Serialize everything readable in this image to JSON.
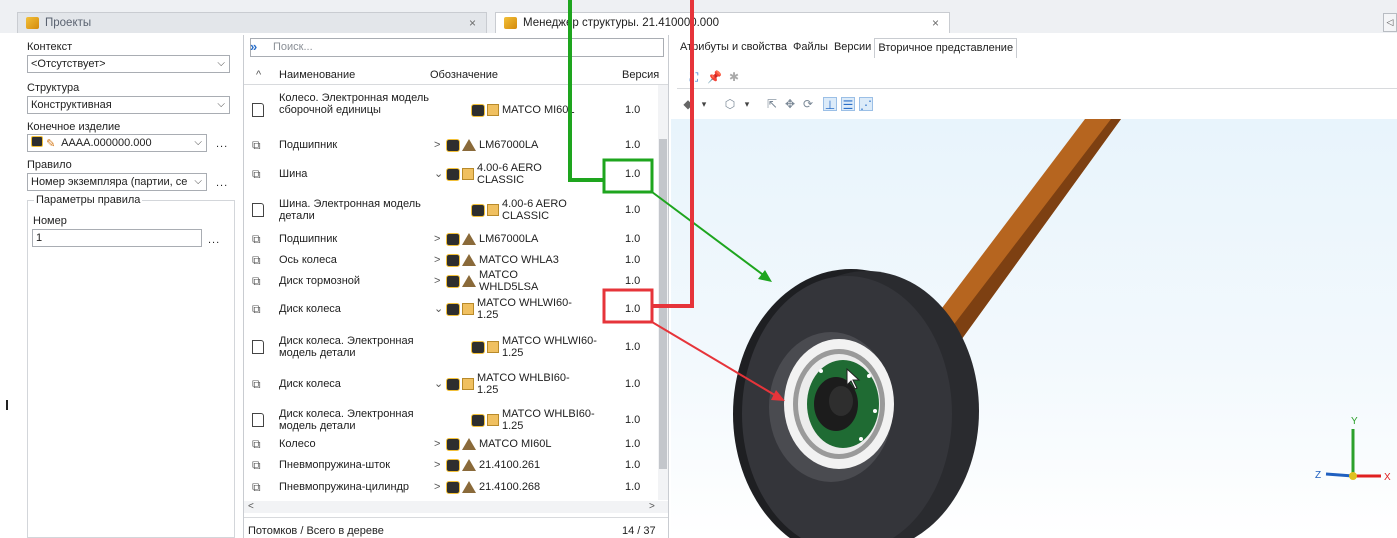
{
  "tabs": [
    {
      "label": "Проекты",
      "close": "×"
    },
    {
      "label": "Менеджер структуры. 21.410000.000",
      "close": "×"
    }
  ],
  "tab_scroll": "◁",
  "left": {
    "context_label": "Контекст",
    "context_value": "<Отсутствует>",
    "structure_label": "Структура",
    "structure_value": "Конструктивная",
    "product_label": "Конечное изделие",
    "product_value": "АААА.000000.000",
    "rule_label": "Правило",
    "rule_value": "Номер экземпляра (партии, се",
    "params_group": "Параметры правила",
    "number_label": "Номер",
    "number_value": "1",
    "dots": "..."
  },
  "middle": {
    "search_placeholder": "Поиск...",
    "search_chevron": "»",
    "col_name": "Наименование",
    "col_designation": "Обозначение",
    "col_version": "Версия",
    "rows": [
      {
        "name": "Колесо. Электронная модель сборочной единицы",
        "expander": "",
        "designation": "MATCO MI60L",
        "version": "1.0",
        "kind": "doc"
      },
      {
        "name": "Подшипник",
        "expander": ">",
        "designation": "LM67000LA",
        "version": "1.0",
        "kind": "part"
      },
      {
        "name": "Шина",
        "expander": "⌄",
        "designation": "4.00-6 AERO CLASSIC",
        "version": "1.0",
        "kind": "part"
      },
      {
        "name": "Шина. Электронная модель детали",
        "expander": "",
        "designation": "4.00-6 AERO CLASSIC",
        "version": "1.0",
        "kind": "doc"
      },
      {
        "name": "Подшипник",
        "expander": ">",
        "designation": "LM67000LA",
        "version": "1.0",
        "kind": "part"
      },
      {
        "name": "Ось колеса",
        "expander": ">",
        "designation": "MATCO WHLA3",
        "version": "1.0",
        "kind": "part"
      },
      {
        "name": "Диск тормозной",
        "expander": ">",
        "designation": "MATCO WHLD5LSA",
        "version": "1.0",
        "kind": "part"
      },
      {
        "name": "Диск колеса",
        "expander": "⌄",
        "designation": "MATCO WHLWI60-1.25",
        "version": "1.0",
        "kind": "part"
      },
      {
        "name": "Диск колеса. Электронная модель детали",
        "expander": "",
        "designation": "MATCO WHLWI60-1.25",
        "version": "1.0",
        "kind": "doc"
      },
      {
        "name": "Диск колеса",
        "expander": "⌄",
        "designation": "MATCO WHLBI60-1.25",
        "version": "1.0",
        "kind": "part"
      },
      {
        "name": "Диск колеса. Электронная модель детали",
        "expander": "",
        "designation": "MATCO WHLBI60-1.25",
        "version": "1.0",
        "kind": "doc"
      },
      {
        "name": "Колесо",
        "expander": ">",
        "designation": "MATCO MI60L",
        "version": "1.0",
        "kind": "part"
      },
      {
        "name": "Пневмопружина-шток",
        "expander": ">",
        "designation": "21.4100.261",
        "version": "1.0",
        "kind": "part"
      },
      {
        "name": "Пневмопружина-цилиндр",
        "expander": ">",
        "designation": "21.4100.268",
        "version": "1.0",
        "kind": "part"
      }
    ],
    "status_label": "Потомков / Всего в дереве",
    "status_value": "14 / 37"
  },
  "right": {
    "tabs": [
      "Атрибуты и свойства",
      "Файлы",
      "Версии",
      "Вторичное представление"
    ],
    "active_tab": "Вторичное представление",
    "axis_x": "X",
    "axis_y": "Y",
    "axis_z": "Z"
  },
  "colors": {
    "highlight_green": "#1ea51e",
    "highlight_red": "#e6343a",
    "tire": "#1e1f22",
    "strut": "#b6651f",
    "hub_green": "#1f6b33"
  }
}
